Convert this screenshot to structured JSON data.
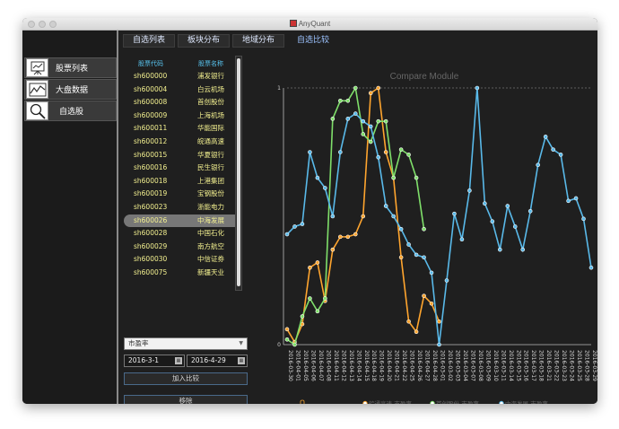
{
  "window": {
    "title": "AnyQuant"
  },
  "sidebar": {
    "items": [
      {
        "label": "股票列表",
        "icon": "easel-chart-icon"
      },
      {
        "label": "大盘数据",
        "icon": "line-chart-icon"
      },
      {
        "label": "自选股",
        "icon": "magnifier-icon"
      }
    ]
  },
  "tabs": [
    {
      "label": "自选列表",
      "active": false
    },
    {
      "label": "板块分布",
      "active": false
    },
    {
      "label": "地域分布",
      "active": false
    },
    {
      "label": "自选比较",
      "active": true
    }
  ],
  "stock_list": {
    "headers": {
      "code": "股票代码",
      "name": "股票名称"
    },
    "rows": [
      {
        "code": "sh600000",
        "name": "浦发银行"
      },
      {
        "code": "sh600004",
        "name": "白云机场"
      },
      {
        "code": "sh600008",
        "name": "首创股份"
      },
      {
        "code": "sh600009",
        "name": "上海机场"
      },
      {
        "code": "sh600011",
        "name": "华能国际"
      },
      {
        "code": "sh600012",
        "name": "皖通高速"
      },
      {
        "code": "sh600015",
        "name": "华夏银行"
      },
      {
        "code": "sh600016",
        "name": "民生银行"
      },
      {
        "code": "sh600018",
        "name": "上港集团"
      },
      {
        "code": "sh600019",
        "name": "宝钢股份"
      },
      {
        "code": "sh600023",
        "name": "浙能电力"
      },
      {
        "code": "sh600026",
        "name": "中海发展",
        "selected": true
      },
      {
        "code": "sh600028",
        "name": "中国石化"
      },
      {
        "code": "sh600029",
        "name": "南方航空"
      },
      {
        "code": "sh600030",
        "name": "中信证券"
      },
      {
        "code": "sh600075",
        "name": "新疆天业"
      }
    ]
  },
  "controls": {
    "metric_select": "市盈率",
    "start_date": "2016-3-1",
    "end_date": "2016-4-29",
    "add_button": "加入比较",
    "remove_button": "移除"
  },
  "chart_data": {
    "type": "line",
    "title": "Compare Module",
    "ylim": [
      0,
      1
    ],
    "yticks": [
      "0",
      "1"
    ],
    "x": [
      "2016-03-30",
      "2016-04-01",
      "2016-04-05",
      "2016-04-06",
      "2016-04-07",
      "2016-04-08",
      "2016-04-11",
      "2016-04-12",
      "2016-04-13",
      "2016-04-14",
      "2016-04-15",
      "2016-04-18",
      "2016-04-19",
      "2016-04-20",
      "2016-04-21",
      "2016-04-22",
      "2016-04-25",
      "2016-04-26",
      "2016-04-27",
      "2016-04-28",
      "2016-03-01",
      "2016-03-02",
      "2016-03-03",
      "2016-03-04",
      "2016-03-07",
      "2016-03-08",
      "2016-03-09",
      "2016-03-10",
      "2016-03-11",
      "2016-03-14",
      "2016-03-15",
      "2016-03-16",
      "2016-03-17",
      "2016-03-18",
      "2016-03-21",
      "2016-03-22",
      "2016-03-23",
      "2016-03-24",
      "2016-03-25",
      "2016-03-28",
      "2016-03-29"
    ],
    "series": [
      {
        "name": "皖通高速-市盈率",
        "color": "#ffa52e",
        "values": [
          0.06,
          0.01,
          0.08,
          0.3,
          0.32,
          0.17,
          0.37,
          0.42,
          0.42,
          0.43,
          0.5,
          0.98,
          1.0,
          0.75,
          0.65,
          0.34,
          0.09,
          0.05,
          0.19,
          0.16,
          0.09
        ]
      },
      {
        "name": "首创股份-市盈率",
        "color": "#7fdf6a",
        "values": [
          0.02,
          0.0,
          0.11,
          0.18,
          0.13,
          0.18,
          0.88,
          0.95,
          0.95,
          1.0,
          0.82,
          0.79,
          0.87,
          0.87,
          0.65,
          0.76,
          0.74,
          0.65,
          0.45
        ]
      },
      {
        "name": "中海发展-市盈率",
        "color": "#59b9e9",
        "values": [
          0.43,
          0.46,
          0.47,
          0.75,
          0.65,
          0.61,
          0.5,
          0.75,
          0.88,
          0.9,
          0.87,
          0.85,
          0.73,
          0.54,
          0.5,
          0.45,
          0.39,
          0.35,
          0.34,
          0.28,
          0.0,
          0.25,
          0.51,
          0.41,
          0.6,
          1.0,
          0.55,
          0.48,
          0.37,
          0.54,
          0.46,
          0.37,
          0.52,
          0.7,
          0.81,
          0.76,
          0.74,
          0.56,
          0.57,
          0.49,
          0.3
        ]
      }
    ]
  }
}
